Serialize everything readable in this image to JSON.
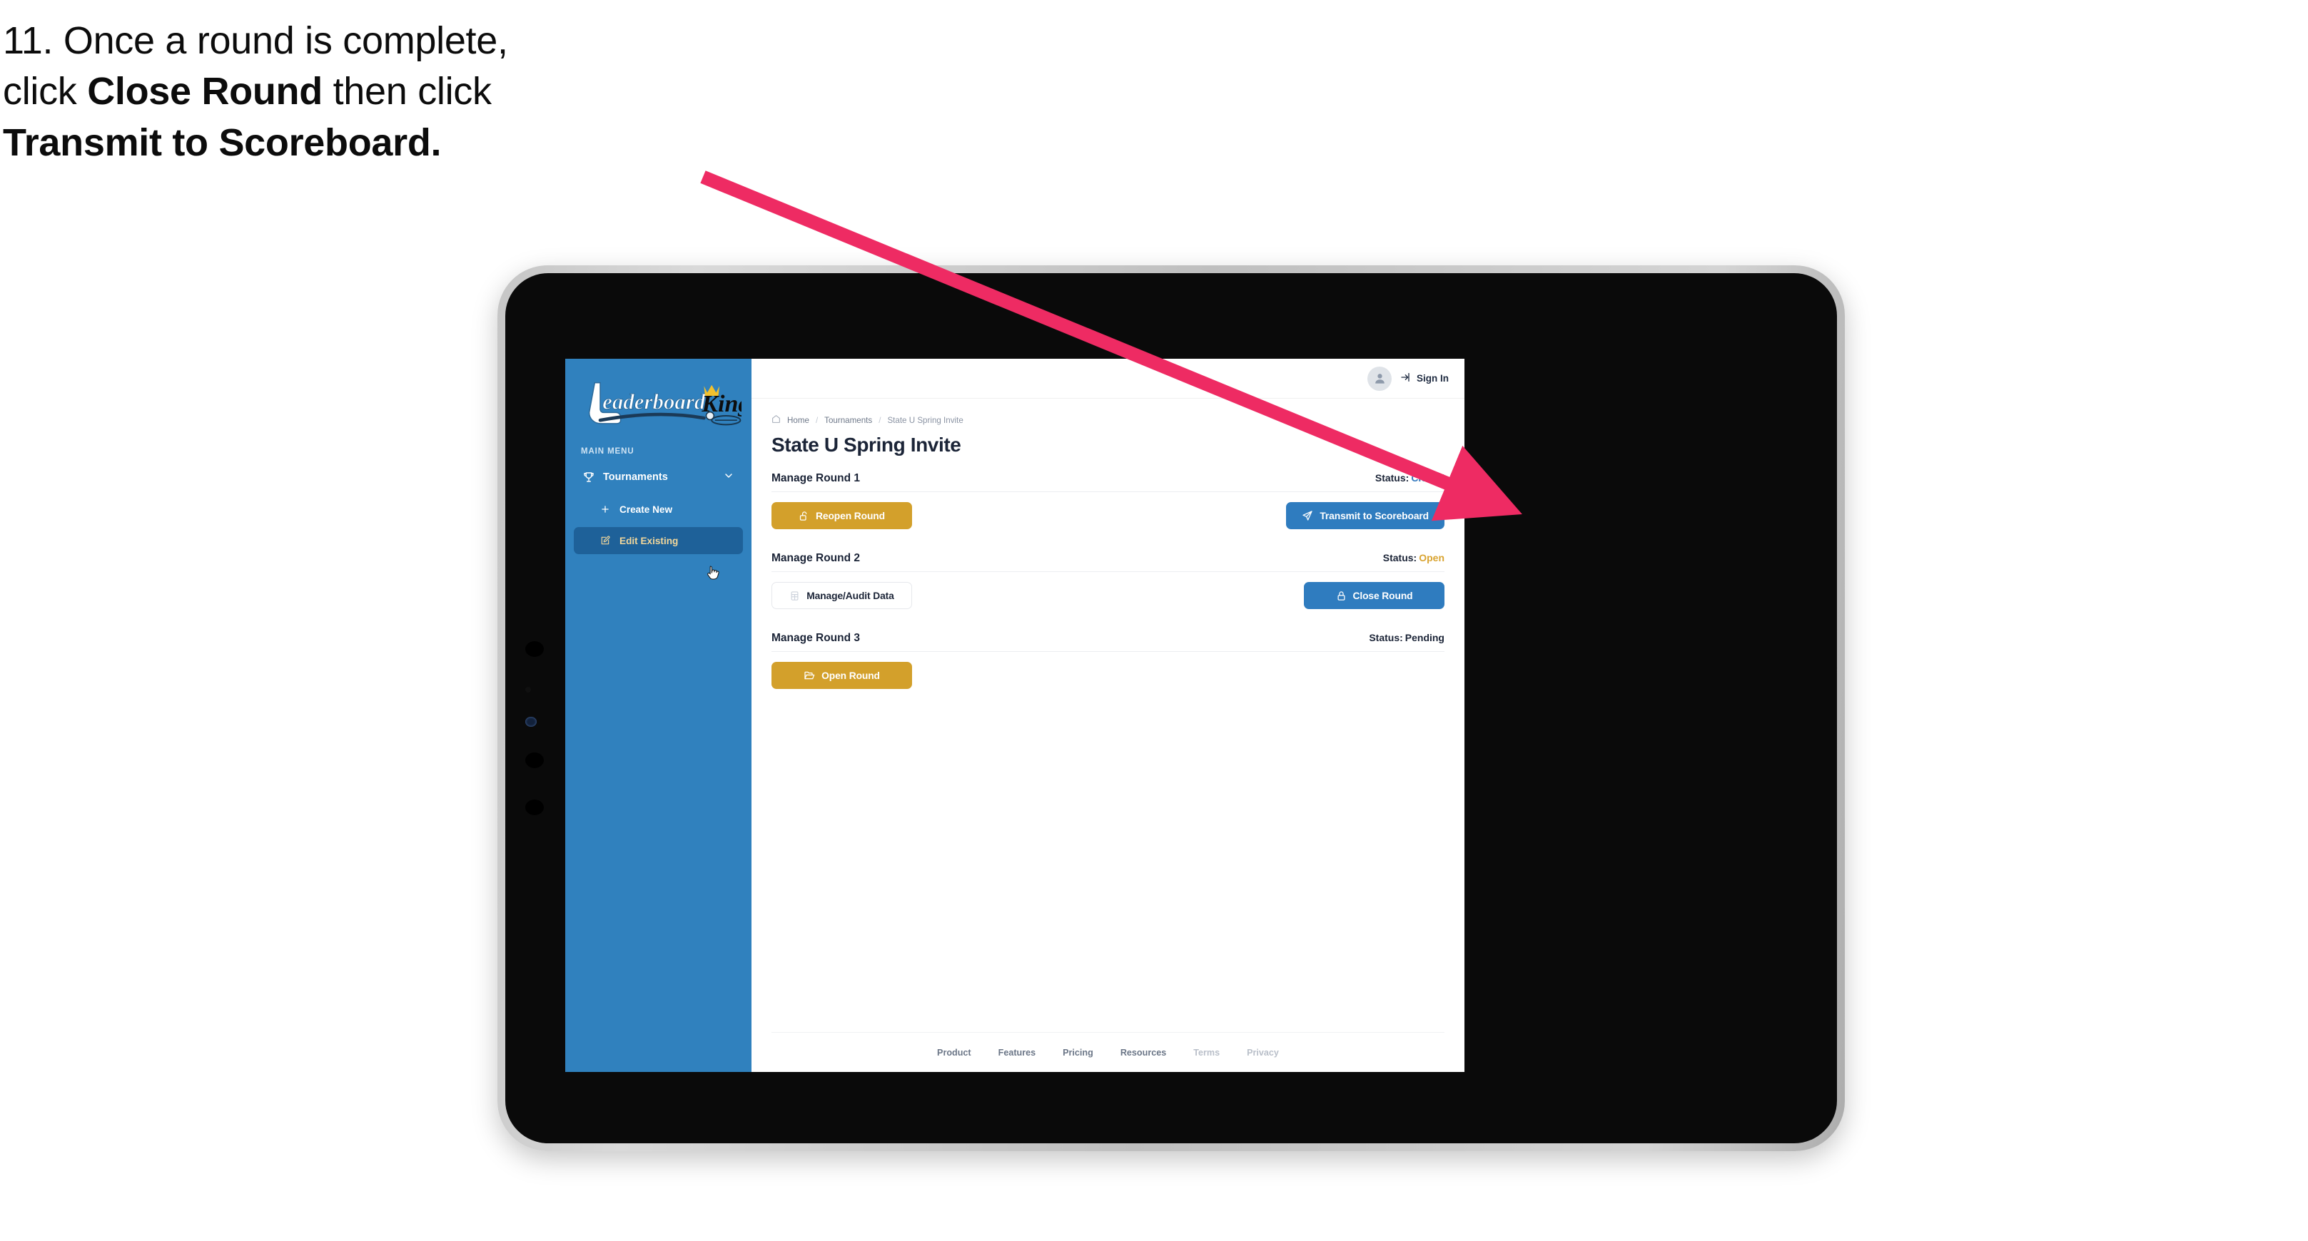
{
  "annotation": {
    "step_number": "11.",
    "line1_prefix": "11. Once a round is complete,",
    "line2_a": "click ",
    "line2_bold": "Close Round",
    "line2_b": " then click",
    "line3_bold": "Transmit to Scoreboard.",
    "arrow_color": "#EE2B63"
  },
  "sidebar": {
    "logo_primary": "Leaderboard",
    "logo_secondary": "King",
    "menu_label": "MAIN MENU",
    "items": [
      {
        "label": "Tournaments",
        "icon": "trophy-icon",
        "expanded": true
      },
      {
        "label": "Create New",
        "icon": "plus-icon",
        "active": false
      },
      {
        "label": "Edit Existing",
        "icon": "edit-square-icon",
        "active": true
      }
    ],
    "bg_color": "#3081BE",
    "active_bg_color": "#1E6199",
    "active_text_color": "#F2D79B"
  },
  "topbar": {
    "sign_in_label": "Sign In",
    "avatar_icon": "user-icon",
    "sign_in_icon": "sign-in-arrow-icon"
  },
  "breadcrumb": {
    "home_icon": "home-icon",
    "items": [
      "Home",
      "Tournaments",
      "State U Spring Invite"
    ],
    "separator": "/"
  },
  "page": {
    "title": "State U Spring Invite",
    "status_prefix": "Status:"
  },
  "rounds": [
    {
      "name": "Manage Round 1",
      "status": "Closed",
      "status_class": "st-closed",
      "left_button": {
        "label": "Reopen Round",
        "style": "gold",
        "icon": "unlock-icon"
      },
      "right_button": {
        "label": "Transmit to Scoreboard",
        "style": "blue",
        "icon": "paper-plane-icon"
      }
    },
    {
      "name": "Manage Round 2",
      "status": "Open",
      "status_class": "st-open",
      "left_button": {
        "label": "Manage/Audit Data",
        "style": "ghost",
        "icon": "table-grid-icon"
      },
      "right_button": {
        "label": "Close Round",
        "style": "blue",
        "icon": "lock-icon"
      }
    },
    {
      "name": "Manage Round 3",
      "status": "Pending",
      "status_class": "st-pending",
      "left_button": {
        "label": "Open Round",
        "style": "gold",
        "icon": "open-folder-icon"
      },
      "right_button": null
    }
  ],
  "footer": {
    "links": [
      "Product",
      "Features",
      "Pricing",
      "Resources",
      "Terms",
      "Privacy"
    ],
    "muted_from_index": 4
  },
  "colors": {
    "gold": "#D3A02B",
    "blue": "#2F7CBF",
    "status_closed": "#3479BE",
    "status_open": "#D9A431",
    "sidebar": "#3081BE",
    "text_dark": "#1b2437"
  },
  "cursor": {
    "type": "pointing-hand",
    "over": "Edit Existing"
  }
}
